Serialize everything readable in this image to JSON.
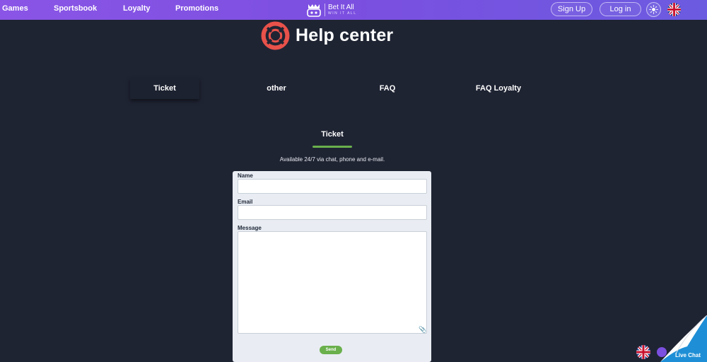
{
  "nav": {
    "items": [
      {
        "label": "Games"
      },
      {
        "label": "Sportsbook"
      },
      {
        "label": "Loyalty"
      },
      {
        "label": "Promotions"
      }
    ],
    "logo_title": "Bet It All",
    "logo_subtitle": "WIN IT ALL",
    "signup_label": "Sign Up",
    "login_label": "Log in",
    "theme_icon": "sun-icon",
    "language_icon": "uk-flag-icon"
  },
  "header": {
    "icon": "lifebuoy-icon",
    "title": "Help center"
  },
  "tabs": [
    {
      "label": "Ticket",
      "active": true
    },
    {
      "label": "other",
      "active": false
    },
    {
      "label": "FAQ",
      "active": false
    },
    {
      "label": "FAQ Loyalty",
      "active": false
    }
  ],
  "section": {
    "title": "Ticket",
    "availability": "Available 24/7 via chat, phone and e-mail."
  },
  "form": {
    "name_label": "Name",
    "name_value": "",
    "email_label": "Email",
    "email_value": "",
    "message_label": "Message",
    "message_value": "",
    "send_label": "Send"
  },
  "live_chat": {
    "label": "Live Chat"
  },
  "colors": {
    "background": "#1f2433",
    "nav_gradient_start": "#8a55e6",
    "nav_gradient_end": "#6b5be0",
    "accent_green": "#6ab04c",
    "logo_red": "#e8524a",
    "form_background": "#e9edf3",
    "live_chat_blue": "#1e8fd6"
  }
}
